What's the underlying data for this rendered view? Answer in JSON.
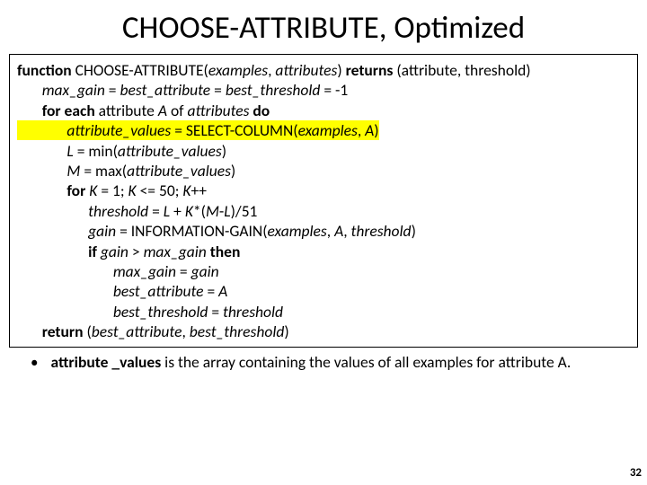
{
  "title": "CHOOSE-ATTRIBUTE, Optimized",
  "code": {
    "l1a": "function",
    "l1b": " CHOOSE-ATTRIBUTE(",
    "l1c": "examples",
    "l1d": ", ",
    "l1e": "attributes",
    "l1f": ") ",
    "l1g": "returns",
    "l1h": " (attribute, threshold)",
    "l2a": "       max_gain ",
    "l2b": "= ",
    "l2c": "best_attribute ",
    "l2d": "= ",
    "l2e": "best_threshold ",
    "l2f": "= -1",
    "l3a": "       for each ",
    "l3b": "attribute ",
    "l3c": "A ",
    "l3d": "of ",
    "l3e": "attributes ",
    "l3f": "do",
    "l4a": "              attribute_values ",
    "l4b": "= SELECT-COLUMN(",
    "l4c": "examples",
    "l4d": ", ",
    "l4e": "A",
    "l4f": ")",
    "l5a": "              L ",
    "l5b": "= min(",
    "l5c": "attribute_values",
    "l5d": ")",
    "l6a": "              M ",
    "l6b": "= max(",
    "l6c": "attribute_values",
    "l6d": ")",
    "l7a": "              for ",
    "l7b": "K ",
    "l7c": "= 1; ",
    "l7d": "K ",
    "l7e": "<= 50; ",
    "l7f": "K",
    "l7g": "++",
    "l8a": "                    threshold ",
    "l8b": "= ",
    "l8c": "L ",
    "l8d": "+ ",
    "l8e": "K",
    "l8f": "*(",
    "l8g": "M",
    "l8h": "-",
    "l8i": "L",
    "l8j": ")/51",
    "l9a": "                    gain ",
    "l9b": "= INFORMATION-GAIN(",
    "l9c": "examples",
    "l9d": ", ",
    "l9e": "A",
    "l9f": ", ",
    "l9g": "threshold",
    "l9h": ")",
    "l10a": "                    if ",
    "l10b": "gain ",
    "l10c": "> ",
    "l10d": "max_gain ",
    "l10e": "then",
    "l11a": "                           max_gain ",
    "l11b": "= ",
    "l11c": "gain",
    "l12a": "                           best_attribute ",
    "l12b": "= ",
    "l12c": "A",
    "l13a": "                           best_threshold ",
    "l13b": "= ",
    "l13c": "threshold",
    "l14a": "       return ",
    "l14b": "(",
    "l14c": "best_attribute",
    "l14d": ", ",
    "l14e": "best_threshold",
    "l14f": ")"
  },
  "note": {
    "bullet": "•",
    "t1": "attribute _values",
    "t2": " is the array containing the values of all examples for attribute A."
  },
  "pagenum": "32"
}
